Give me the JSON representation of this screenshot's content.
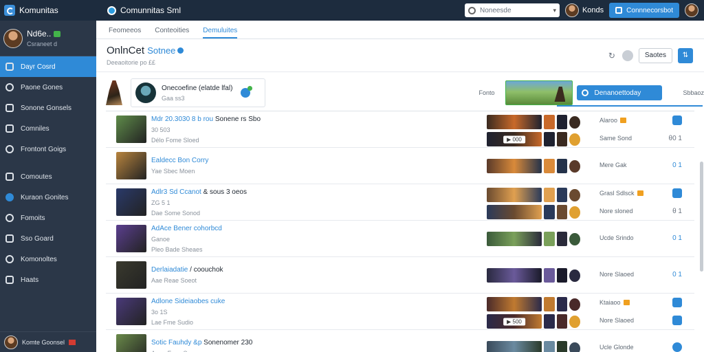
{
  "app": {
    "name": "Komunitas",
    "title": "Comunnitas Sml"
  },
  "topbar": {
    "search_placeholder": "Noneesde",
    "user_name": "Konds",
    "action_label": "Connnecorsbot"
  },
  "sidebar": {
    "profile": {
      "name": "Nd6e..",
      "sub": "Csraneet d"
    },
    "items": [
      {
        "label": "Dayr Cosrd",
        "icon": "dashboard-icon",
        "active": true
      },
      {
        "label": "Paone Gones",
        "icon": "clock-icon",
        "active": false
      },
      {
        "label": "Sonone Gonsels",
        "icon": "chat-icon",
        "active": false
      },
      {
        "label": "Comniles",
        "icon": "monitor-icon",
        "active": false
      },
      {
        "label": "Frontont Goigs",
        "icon": "gear-icon",
        "active": false
      },
      {
        "label": "Comoutes",
        "icon": "grid-icon",
        "active": false
      },
      {
        "label": "Kuraon Gonites",
        "icon": "globe-icon",
        "active": false
      },
      {
        "label": "Fomoits",
        "icon": "search-icon",
        "active": false
      },
      {
        "label": "Sso Goard",
        "icon": "calendar-icon",
        "active": false
      },
      {
        "label": "Komonoltes",
        "icon": "heart-icon",
        "active": false
      },
      {
        "label": "Haats",
        "icon": "list-icon",
        "active": false
      }
    ],
    "footer": "Komte Goonsel"
  },
  "tabs": [
    {
      "label": "Feomeeos",
      "active": false
    },
    {
      "label": "Conteoities",
      "active": false
    },
    {
      "label": "Demuluites",
      "active": true
    }
  ],
  "header": {
    "title": "OnlnCet",
    "title_accent": "Sotnee",
    "subtitle": "Deeaoitorie po ££ ",
    "sort_label": "Saotes"
  },
  "featured": {
    "title": "Onecoefine (elatde lfal)",
    "sub": "Gaa ss3",
    "label": "Fonto",
    "action": "Denanoettoday",
    "link": "Sbbaoz"
  },
  "rows": [
    {
      "title": "Mdr 20.3030 8 b rou",
      "title_plain": "Sonene rs Sbo",
      "meta": "30 503",
      "meta2": "Délo  Fome  Sloed",
      "side": [
        {
          "name": "Alaroo",
          "end": "icon"
        },
        {
          "name": "Same Sond",
          "end": "θ0 1"
        }
      ],
      "thumb": "#5f8c4a",
      "play": "▶ 000"
    },
    {
      "title": "Ealdecc Bon Corry",
      "title_plain": "",
      "meta": "Yae  Sbec  Moen",
      "meta2": "",
      "side": [
        {
          "name": "Mere Gak",
          "end": "0 1"
        }
      ],
      "thumb": "#b8843e",
      "play": ""
    },
    {
      "title": "Adlr3 Sd Ccanot",
      "title_plain": "& sous 3 oeos",
      "meta": "ZG 5 1",
      "meta2": "Dae  Some  Sonod",
      "side": [
        {
          "name": "Grasl Sdlsck",
          "end": "icon"
        },
        {
          "name": "Nore sloned",
          "end": "θ 1"
        }
      ],
      "thumb": "#2a3a6a",
      "play": ""
    },
    {
      "title": "AdAce Bener cohorbcd",
      "title_plain": "",
      "meta": "Ganoe",
      "meta2": "Pleo  Bade  Sheaes",
      "side": [
        {
          "name": "Ucde Srindo",
          "end": "0 1"
        }
      ],
      "thumb": "#5b3f8f",
      "play": ""
    },
    {
      "title": "Derlaiadatie",
      "title_plain": "/ coouchok",
      "meta": "Aae  Reae  Soeot",
      "meta2": "",
      "side": [
        {
          "name": "Nore Slaoed",
          "end": "0 1"
        }
      ],
      "thumb": "#3a3a2e",
      "play": ""
    },
    {
      "title": "Adlone Sideiaobes cuke",
      "title_plain": "",
      "meta": "3o 1S",
      "meta2": "Lae  Fme  Sudio",
      "side": [
        {
          "name": "Ktaiaoo",
          "end": "icon"
        },
        {
          "name": "Nore Slaoed",
          "end": "icon"
        }
      ],
      "thumb": "#4a3a7a",
      "play": "▶ 500"
    },
    {
      "title": "Sotic Fauhdy &p",
      "title_plain": "Sonenomer 230",
      "meta": "Anue  Faoe  Scoe",
      "meta2": "",
      "side": [
        {
          "name": "Ucle Glonde",
          "end": "round"
        }
      ],
      "thumb": "#6a8a4a",
      "play": ""
    }
  ],
  "colors": {
    "accent": "#2f8ad7",
    "sidebar": "#2b3748",
    "topbar": "#1d2c3e",
    "green": "#43b34a"
  }
}
